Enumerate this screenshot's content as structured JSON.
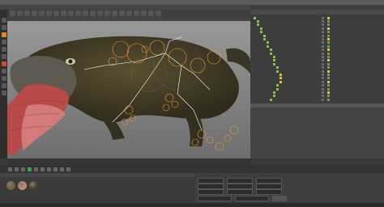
{
  "window": {
    "title": ""
  },
  "menubar": {
    "items": [
      "",
      "",
      "",
      "",
      "",
      "",
      "",
      "",
      "",
      "",
      "",
      "",
      "",
      "",
      "",
      "",
      ""
    ]
  },
  "viewport": {
    "header_items": [
      "",
      "",
      "",
      "",
      ""
    ]
  },
  "object_manager": {
    "tabs": [
      "",
      "",
      "",
      "",
      ""
    ],
    "rows": [
      {
        "label": "",
        "indent": 0,
        "color": "#8fbf4a"
      },
      {
        "label": "",
        "indent": 1,
        "color": "#8fbf4a"
      },
      {
        "label": "",
        "indent": 1,
        "color": "#8fbf4a"
      },
      {
        "label": "",
        "indent": 2,
        "color": "#8fbf4a"
      },
      {
        "label": "",
        "indent": 2,
        "color": "#8fbf4a"
      },
      {
        "label": "",
        "indent": 3,
        "color": "#8fbf4a"
      },
      {
        "label": "",
        "indent": 3,
        "color": "#8fbf4a"
      },
      {
        "label": "",
        "indent": 4,
        "color": "#8fbf4a"
      },
      {
        "label": "",
        "indent": 4,
        "color": "#8fbf4a"
      },
      {
        "label": "",
        "indent": 5,
        "color": "#8fbf4a"
      },
      {
        "label": "",
        "indent": 5,
        "color": "#8fbf4a"
      },
      {
        "label": "",
        "indent": 6,
        "color": "#8fbf4a"
      },
      {
        "label": "",
        "indent": 6,
        "color": "#8fbf4a"
      },
      {
        "label": "",
        "indent": 6,
        "color": "#8fbf4a"
      },
      {
        "label": "",
        "indent": 7,
        "color": "#8fbf4a"
      },
      {
        "label": "",
        "indent": 7,
        "color": "#8fbf4a"
      },
      {
        "label": "",
        "indent": 8,
        "color": "#e0c93a"
      },
      {
        "label": "",
        "indent": 8,
        "color": "#e0c93a"
      },
      {
        "label": "",
        "indent": 8,
        "color": "#e0c93a"
      },
      {
        "label": "",
        "indent": 7,
        "color": "#8fbf4a"
      },
      {
        "label": "",
        "indent": 7,
        "color": "#8fbf4a"
      },
      {
        "label": "",
        "indent": 6,
        "color": "#8fbf4a"
      },
      {
        "label": "",
        "indent": 6,
        "color": "#8fbf4a"
      },
      {
        "label": "",
        "indent": 5,
        "color": "#8fbf4a"
      }
    ]
  },
  "attributes": {
    "tabs": [
      "",
      "",
      "",
      ""
    ]
  },
  "materials": {
    "tabs": [
      "",
      "",
      "",
      "",
      ""
    ],
    "swatches": [
      "#7a5b3a",
      "#c98a6a",
      "#4a3c2a"
    ]
  },
  "statusbar": {
    "text": ""
  },
  "colors": {
    "accent_orange": "#e0862a",
    "green_play": "#2fae3b",
    "selection_orange": "#e89a3a"
  }
}
